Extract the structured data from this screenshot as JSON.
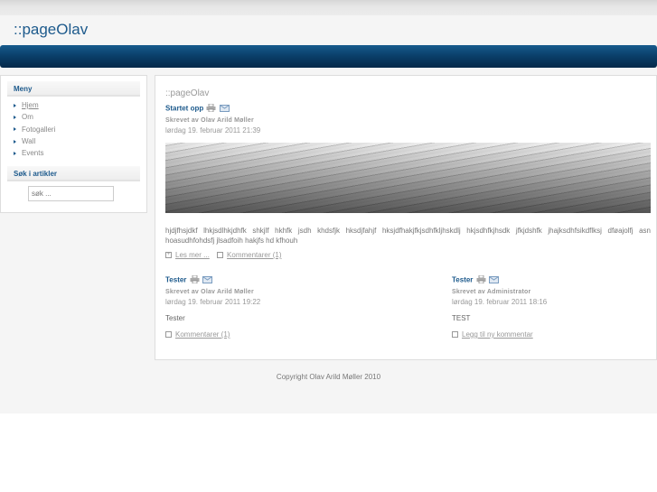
{
  "site": {
    "title": "::pageOlav"
  },
  "sidebar": {
    "menu_title": "Meny",
    "items": [
      {
        "label": "Hjem"
      },
      {
        "label": "Om"
      },
      {
        "label": "Fotogalleri"
      },
      {
        "label": "Wall"
      },
      {
        "label": "Events"
      }
    ],
    "search_title": "Søk i artikler",
    "search_placeholder": "søk ..."
  },
  "main": {
    "page_title": "::pageOlav",
    "lead": {
      "title": "Startet opp",
      "author": "Skrevet av Olav Arild Møller",
      "date": "lørdag 19. februar 2011 21:39",
      "body": "hjdjfhsjdkf lhkjsdlhkjdhfk shkjlf hkhfk jsdh khdsfjk hksdjfahjf hksjdfhakjfkjsdhfkljhskdlj hkjsdhfkjhsdk jfkjdshfk jhajksdhfsikdflksj dføajolfj asn hoasudhfohdsfj jlsadfoih hakjfs hd kfhouh",
      "read_more": "Les mer ...",
      "comments": "Kommentarer (1)"
    },
    "articles": [
      {
        "title": "Tester",
        "author": "Skrevet av Olav Arild Møller",
        "date": "lørdag 19. februar 2011 19:22",
        "body": "Tester",
        "link": "Kommentarer (1)"
      },
      {
        "title": "Tester",
        "author": "Skrevet av Administrator",
        "date": "lørdag 19. februar 2011 18:16",
        "body": "TEST",
        "link": "Legg til ny kommentar"
      }
    ]
  },
  "footer": {
    "text": "Copyright Olav Arild Møller 2010"
  }
}
